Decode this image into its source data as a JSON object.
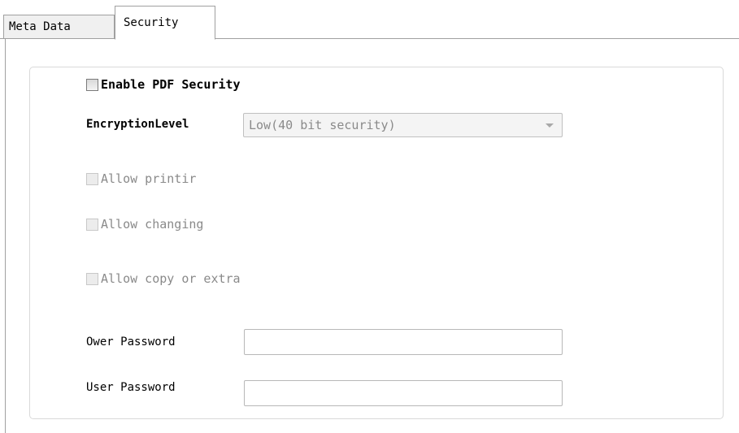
{
  "tabs": [
    {
      "label": "Meta Data",
      "active": false
    },
    {
      "label": "Security",
      "active": true
    }
  ],
  "security": {
    "enable_label": "Enable PDF Security",
    "enable_checked": false,
    "encryption_label": "EncryptionLevel",
    "encryption_value": "Low(40 bit security)",
    "permissions": [
      {
        "label": "Allow printir",
        "checked": false,
        "enabled": false
      },
      {
        "label": "Allow changing",
        "checked": false,
        "enabled": false
      },
      {
        "label": "Allow copy or extra",
        "checked": false,
        "enabled": false
      }
    ],
    "owner_password_label": "Ower Password",
    "owner_password_value": "",
    "user_password_label": "User Password",
    "user_password_value": ""
  },
  "colors": {
    "border": "#a0a0a0",
    "disabled_text": "#8a8a8a",
    "groupbox_border": "#d9d9d9"
  }
}
